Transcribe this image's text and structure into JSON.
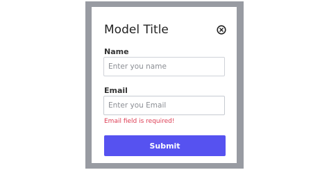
{
  "modal": {
    "title": "Model Title",
    "close_icon": "close-circle-x-icon"
  },
  "form": {
    "name": {
      "label": "Name",
      "value": "",
      "placeholder": "Enter you name"
    },
    "email": {
      "label": "Email",
      "value": "",
      "placeholder": "Enter you Email",
      "error": "Email field is required!"
    },
    "submit_label": "Submit"
  },
  "colors": {
    "overlay": "#989ba2",
    "primary": "#5652f0",
    "error": "#dd3b52"
  }
}
